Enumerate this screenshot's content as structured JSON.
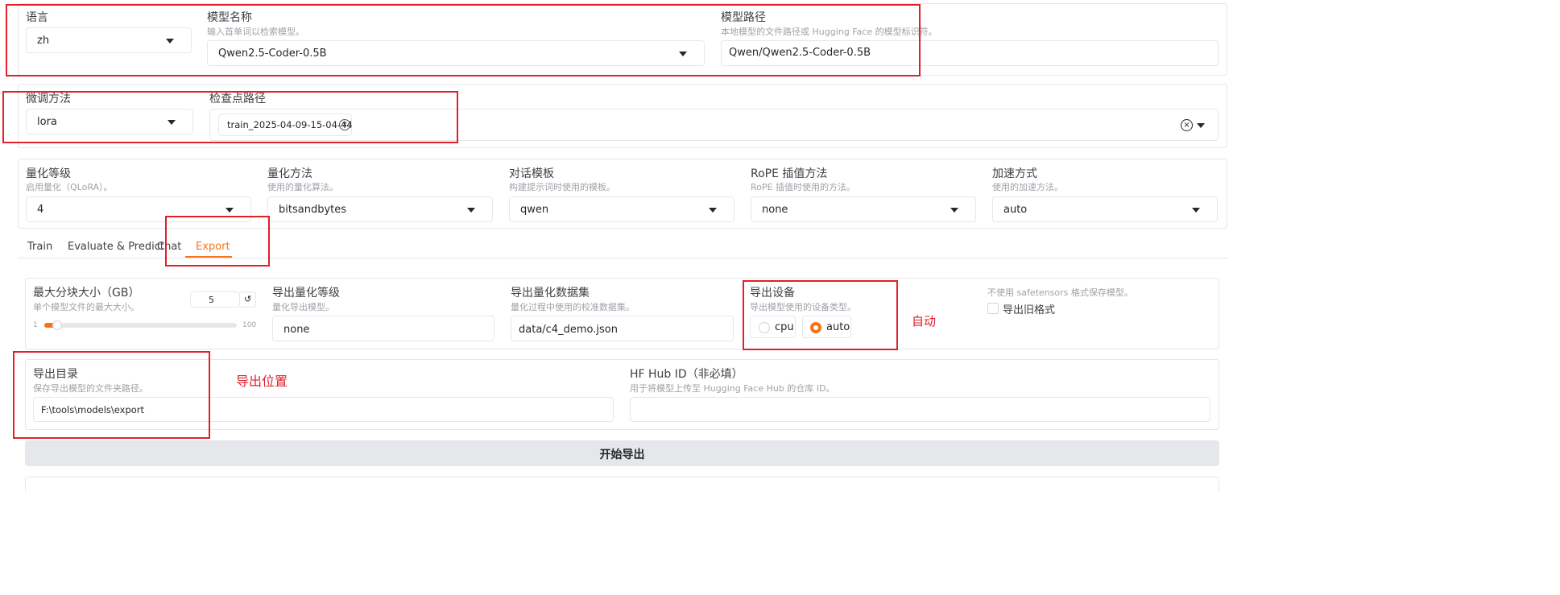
{
  "model_panel": {
    "lang": {
      "label": "语言",
      "value": "zh"
    },
    "model_name": {
      "label": "模型名称",
      "info": "输入首单词以检索模型。",
      "value": "Qwen2.5-Coder-0.5B"
    },
    "model_path": {
      "label": "模型路径",
      "info": "本地模型的文件路径或 Hugging Face 的模型标识符。",
      "value": "Qwen/Qwen2.5-Coder-0.5B"
    }
  },
  "finetune_panel": {
    "method": {
      "label": "微调方法",
      "value": "lora"
    },
    "checkpoint": {
      "label": "检查点路径",
      "chip": "train_2025-04-09-15-04-44",
      "chip_remove": "×",
      "clear": "×"
    }
  },
  "quant_panel": {
    "quant_bit": {
      "label": "量化等级",
      "info": "启用量化（QLoRA）。",
      "value": "4"
    },
    "quant_method": {
      "label": "量化方法",
      "info": "使用的量化算法。",
      "value": "bitsandbytes"
    },
    "template": {
      "label": "对话模板",
      "info": "构建提示词时使用的模板。",
      "value": "qwen"
    },
    "rope": {
      "label": "RoPE 插值方法",
      "info": "RoPE 插值时使用的方法。",
      "value": "none"
    },
    "booster": {
      "label": "加速方式",
      "info": "使用的加速方法。",
      "value": "auto"
    }
  },
  "tabs": [
    {
      "label": "Train",
      "active": false
    },
    {
      "label": "Evaluate & Predict",
      "active": false
    },
    {
      "label": "Chat",
      "active": false
    },
    {
      "label": "Export",
      "active": true
    }
  ],
  "export_panel": {
    "shard_size": {
      "label": "最大分块大小（GB）",
      "info": "单个模型文件的最大大小。",
      "value": "5",
      "reset": "↺",
      "min": "1",
      "max": "100",
      "fraction": 0.04
    },
    "export_quant_bit": {
      "label": "导出量化等级",
      "info": "量化导出模型。",
      "value": "none"
    },
    "export_quant_dataset": {
      "label": "导出量化数据集",
      "info": "量化过程中使用的校准数据集。",
      "value": "data/c4_demo.json"
    },
    "export_device": {
      "label": "导出设备",
      "info": "导出模型使用的设备类型。",
      "options": [
        "cpu",
        "auto"
      ],
      "selected": "auto"
    },
    "legacy": {
      "info": "不使用 safetensors 格式保存模型。",
      "label": "导出旧格式"
    },
    "export_dir": {
      "label": "导出目录",
      "info": "保存导出模型的文件夹路径。",
      "value": "F:\\tools\\models\\export"
    },
    "hub_id": {
      "label": "HF Hub ID（非必填）",
      "info": "用于将模型上传至 Hugging Face Hub 的仓库 ID。",
      "value": ""
    },
    "start_button": "开始导出"
  },
  "annotations": {
    "auto": "自动",
    "export_location": "导出位置"
  },
  "colors": {
    "accent": "#f97316",
    "annotation": "#e0202a"
  }
}
